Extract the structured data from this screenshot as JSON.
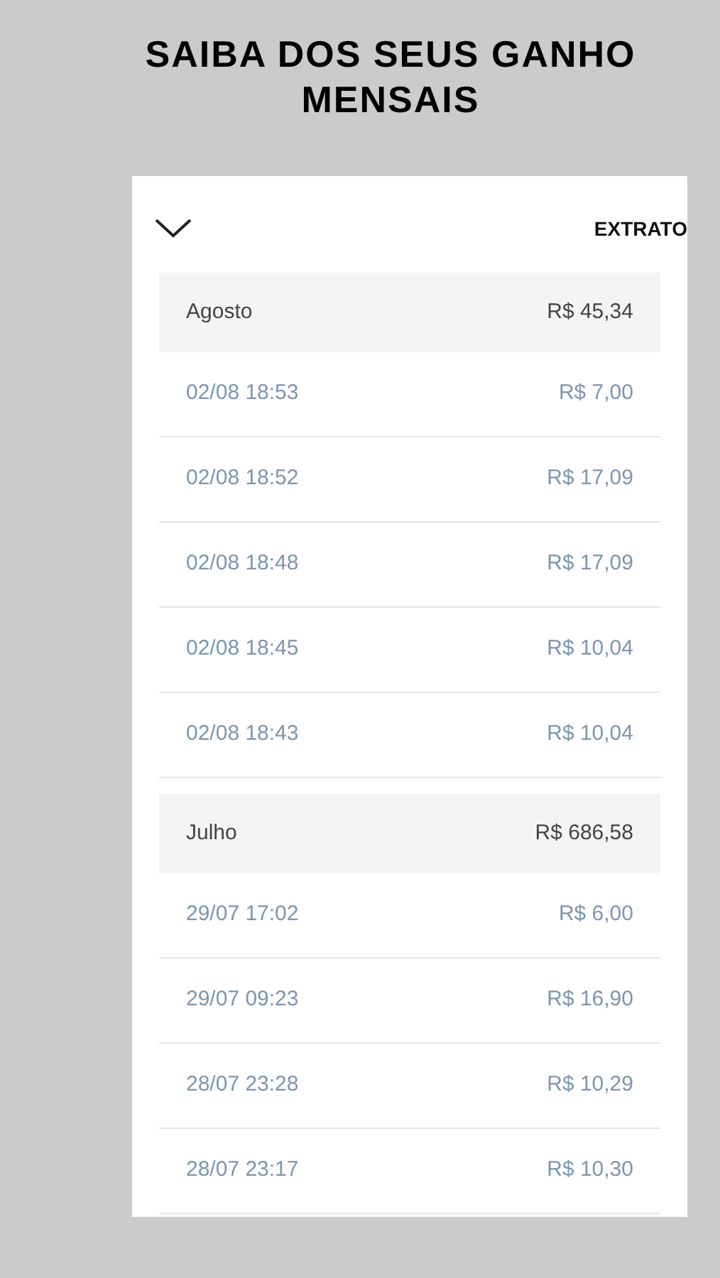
{
  "headline": [
    "SAIBA DOS SEUS GANHO",
    "MENSAIS"
  ],
  "screen": {
    "title": "EXTRATO",
    "months": [
      {
        "name": "Agosto",
        "total": "R$ 45,34",
        "entries": [
          {
            "time": "02/08 18:53",
            "amount": "R$ 7,00"
          },
          {
            "time": "02/08 18:52",
            "amount": "R$ 17,09"
          },
          {
            "time": "02/08 18:48",
            "amount": "R$ 17,09"
          },
          {
            "time": "02/08 18:45",
            "amount": "R$ 10,04"
          },
          {
            "time": "02/08 18:43",
            "amount": "R$ 10,04"
          }
        ]
      },
      {
        "name": "Julho",
        "total": "R$ 686,58",
        "entries": [
          {
            "time": "29/07 17:02",
            "amount": "R$ 6,00"
          },
          {
            "time": "29/07 09:23",
            "amount": "R$ 16,90"
          },
          {
            "time": "28/07 23:28",
            "amount": "R$ 10,29"
          },
          {
            "time": "28/07 23:17",
            "amount": "R$ 10,30"
          }
        ]
      }
    ]
  }
}
